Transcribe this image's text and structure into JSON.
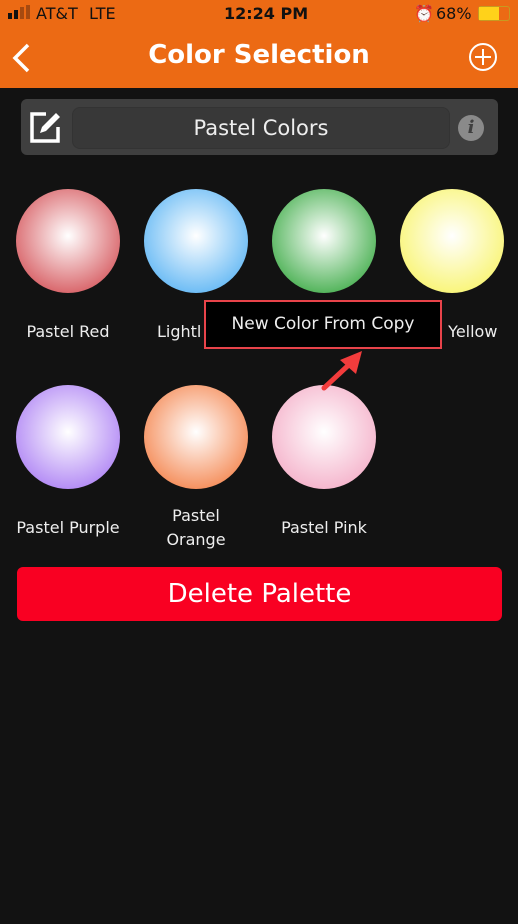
{
  "status": {
    "carrier": "AT&T",
    "network": "LTE",
    "time": "12:24 PM",
    "battery": "68%",
    "battery_level": 0.68
  },
  "header": {
    "title": "Color Selection",
    "back_icon": "chevron-left-icon",
    "add_icon": "plus-circle-icon"
  },
  "palette": {
    "name": "Pastel Colors",
    "edit_icon": "edit-icon",
    "info_icon": "info-icon"
  },
  "colors": [
    {
      "label": "Pastel Red",
      "color": "#d9666b"
    },
    {
      "label": "Lightl",
      "color": "#6cbcf5"
    },
    {
      "label": "",
      "color": "#52b45a"
    },
    {
      "label": ". Yellow",
      "color": "#f9f57a"
    },
    {
      "label": "Pastel Purple",
      "color": "#b48cf5"
    },
    {
      "label": "Pastel Orange",
      "color": "#f5905e"
    },
    {
      "label": "Pastel Pink",
      "color": "#f5b6cd"
    }
  ],
  "delete_label": "Delete Palette",
  "popup": {
    "label": "New Color From Copy",
    "highlight_color": "#e8434a"
  }
}
